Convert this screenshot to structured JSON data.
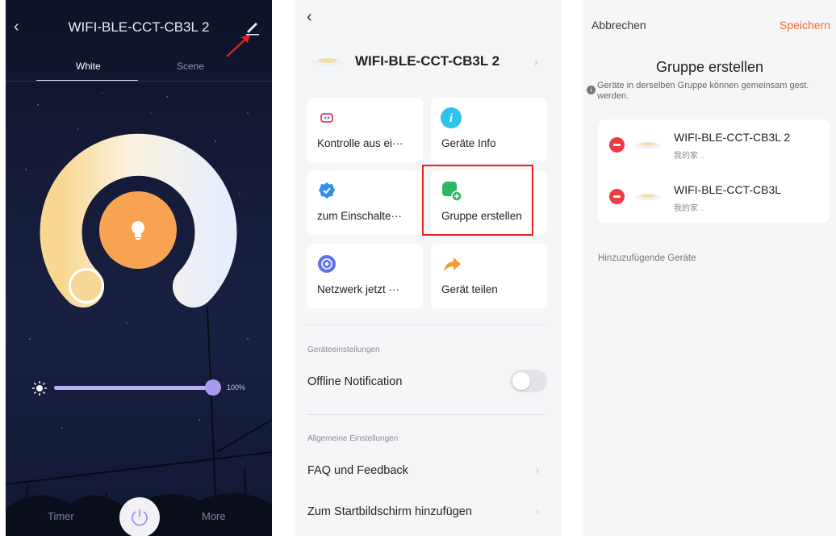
{
  "control": {
    "device_title": "WIFI-BLE-CCT-CB3L 2",
    "tabs": [
      "White",
      "Scene"
    ],
    "brightness": 1.0,
    "brightness_label": "100%",
    "timer_label": "Timer",
    "more_label": "More",
    "colors": {
      "warm": "#f7d795",
      "cool": "#e6eefb",
      "bulb": "#f7a352",
      "slider": "#b8b0f2"
    }
  },
  "settings": {
    "device_title": "WIFI-BLE-CCT-CB3L 2",
    "tiles": [
      {
        "label": "Kontrolle aus ei···",
        "icon": "remote-icon"
      },
      {
        "label": "Geräte Info",
        "icon": "info-icon"
      },
      {
        "label": "zum Einschalte···",
        "icon": "check-badge-icon"
      },
      {
        "label": "Gruppe erstellen",
        "icon": "group-add-icon"
      },
      {
        "label": "Netzwerk jetzt ···",
        "icon": "network-icon"
      },
      {
        "label": "Gerät teilen",
        "icon": "share-icon"
      }
    ],
    "section_device": "Geräteeinstellungen",
    "offline_notification": "Offline Notification",
    "offline_enabled": false,
    "section_general": "Allgemeine Einstellungen",
    "faq": "FAQ und Feedback",
    "home_screen": "Zum Startbildschirm hinzufügen",
    "highlight_color": "#e8221f"
  },
  "group": {
    "cancel": "Abbrechen",
    "save": "Speichern",
    "title": "Gruppe erstellen",
    "description": "Geräte in derselben Gruppe können gemeinsam gest. werden.",
    "devices": [
      {
        "name": "WIFI-BLE-CCT-CB3L 2",
        "location": "我的家 .."
      },
      {
        "name": "WIFI-BLE-CCT-CB3L",
        "location": "我的家 .."
      }
    ],
    "add_section": "Hinzuzufügende Geräte",
    "accent": "#fd6a2c"
  }
}
